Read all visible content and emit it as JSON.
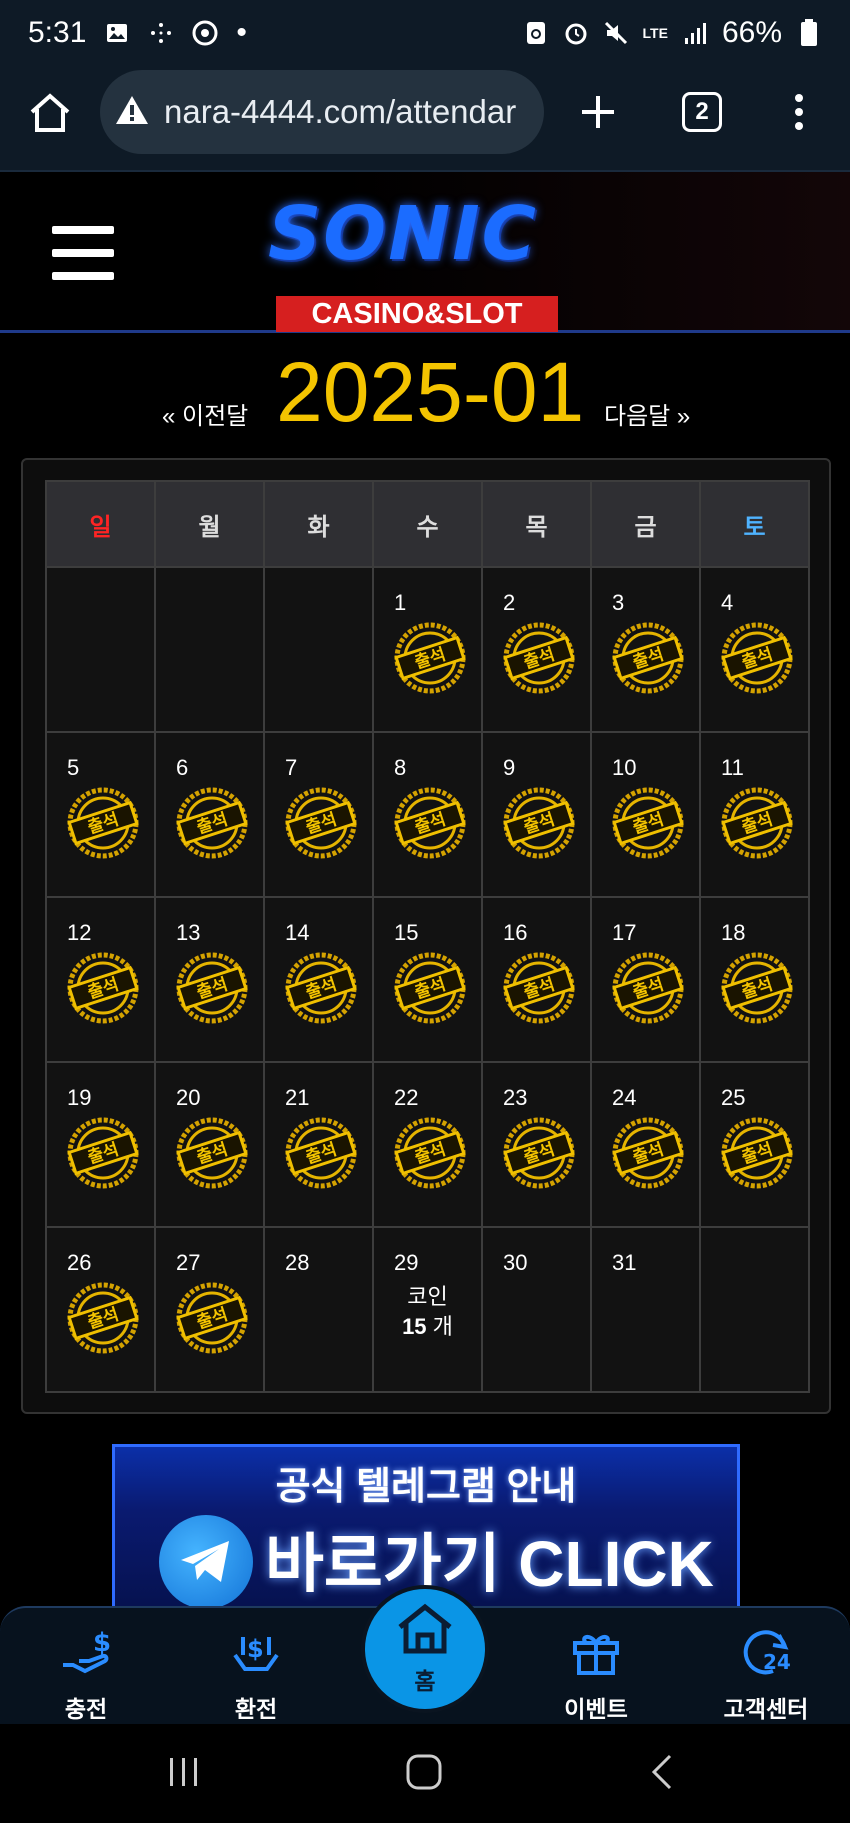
{
  "status_bar": {
    "time": "5:31",
    "battery": "66%",
    "network": "LTE"
  },
  "browser": {
    "url": "nara-4444.com/attendar",
    "tab_count": "2"
  },
  "site": {
    "logo_main": "SONIC",
    "logo_sub": "CASINO&SLOT"
  },
  "calendar": {
    "prev_label": "« 이전달",
    "month": "2025-01",
    "next_label": "다음달 »",
    "weekdays": [
      "일",
      "월",
      "화",
      "수",
      "목",
      "금",
      "토"
    ],
    "stamp_text": "출석",
    "coin_label": "코인",
    "coin_count": "15",
    "coin_unit": "개",
    "attended_days": [
      1,
      2,
      3,
      4,
      5,
      6,
      7,
      8,
      9,
      10,
      11,
      12,
      13,
      14,
      15,
      16,
      17,
      18,
      19,
      20,
      21,
      22,
      23,
      24,
      25,
      26,
      27
    ],
    "coin_day": 29,
    "days": [
      "1",
      "2",
      "3",
      "4",
      "5",
      "6",
      "7",
      "8",
      "9",
      "10",
      "11",
      "12",
      "13",
      "14",
      "15",
      "16",
      "17",
      "18",
      "19",
      "20",
      "21",
      "22",
      "23",
      "24",
      "25",
      "26",
      "27",
      "28",
      "29",
      "30",
      "31"
    ]
  },
  "banner": {
    "title": "공식 텔레그램 안내",
    "cta": "바로가기 CLICK"
  },
  "bottom_nav": {
    "charge": "충전",
    "exchange": "환전",
    "home": "홈",
    "event": "이벤트",
    "support": "고객센터"
  },
  "colors": {
    "accent_gold": "#f4c400",
    "sunday": "#ff2424",
    "saturday": "#4fb3ff",
    "home_button": "#0a95e6"
  }
}
